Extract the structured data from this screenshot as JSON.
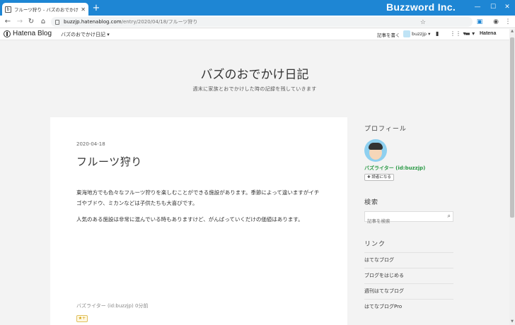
{
  "browser": {
    "tab_title": "フルーツ狩り - バズのおでかけ日記",
    "tab_favicon": "はてなブログ favicon",
    "brand_overlay": "Buzzword Inc.",
    "url_host": "buzzjp.hatenablog.com",
    "url_path": "/entry/2020/04/18/フルーツ狩り",
    "icons": [
      "back-icon",
      "forward-icon",
      "reload-icon",
      "home-icon",
      "lock-icon",
      "star-icon",
      "extension-icon",
      "profile-icon",
      "menu-icon"
    ]
  },
  "hatena_bar": {
    "logo": "Hatena Blog",
    "blog_menu": "バズのおでかけ日記 ▾",
    "write_link": "記事を書く",
    "user_menu": "buzzjp ▾",
    "right_logo": "Hatena"
  },
  "blog": {
    "title": "バズのおでかけ日記",
    "description": "週末に家族とおでかけした時の記録を残していきます"
  },
  "article": {
    "date": "2020-04-18",
    "title": "フルーツ狩り",
    "paragraphs": [
      "東海地方でも色々なフルーツ狩りを楽しむことができる施設があります。季節によって違いますがイチゴやブドウ、ミカンなどは子供たちも大喜びです。",
      "人気のある施設は非常に混んでいる時もありますけど、がんばっていくだけの価値はあります。"
    ],
    "author_line": "バズライター (id:buzzjp) 0分前",
    "star_button": "★+"
  },
  "sidebar": {
    "profile_heading": "プロフィール",
    "profile_name": "バズライター (id:buzzjp)",
    "reader_button": "✚ 読者になる",
    "search_heading": "検索",
    "search_placeholder": "記事を検索",
    "links_heading": "リンク",
    "links": [
      "はてなブログ",
      "ブログをはじめる",
      "週刊はてなブログ",
      "はてなブログPro"
    ]
  },
  "colors": {
    "titlebar": "#1e86d4",
    "profile_name": "#2b9a46",
    "page_bg": "#f3f3f3"
  }
}
